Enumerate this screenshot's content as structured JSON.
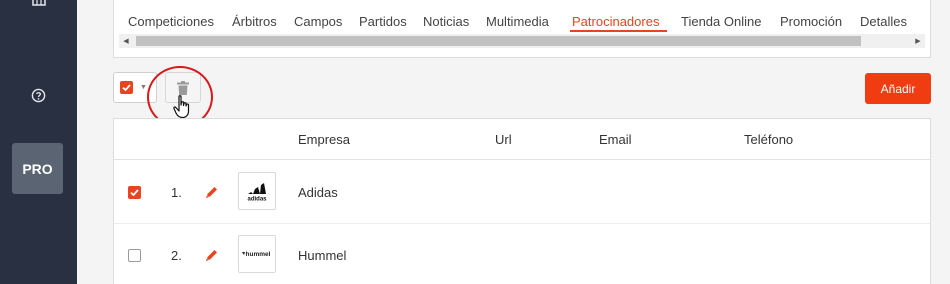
{
  "sidebar": {
    "pro_label": "PRO"
  },
  "tabs": [
    {
      "label": "Competiciones"
    },
    {
      "label": "Árbitros"
    },
    {
      "label": "Campos"
    },
    {
      "label": "Partidos"
    },
    {
      "label": "Noticias"
    },
    {
      "label": "Multimedia"
    },
    {
      "label": "Patrocinadores",
      "active": true
    },
    {
      "label": "Tienda Online"
    },
    {
      "label": "Promoción"
    },
    {
      "label": "Detalles"
    }
  ],
  "toolbar": {
    "add_label": "Añadir"
  },
  "table": {
    "columns": [
      "Empresa",
      "Url",
      "Email",
      "Teléfono"
    ],
    "rows": [
      {
        "num": "1.",
        "company": "Adidas",
        "checked": true,
        "logo_text": "adidas"
      },
      {
        "num": "2.",
        "company": "Hummel",
        "checked": false,
        "logo_text": "hummel"
      }
    ]
  },
  "colors": {
    "accent": "#e8451e",
    "add_button": "#f03c10",
    "sidebar": "#283041",
    "highlight": "#d81919"
  }
}
